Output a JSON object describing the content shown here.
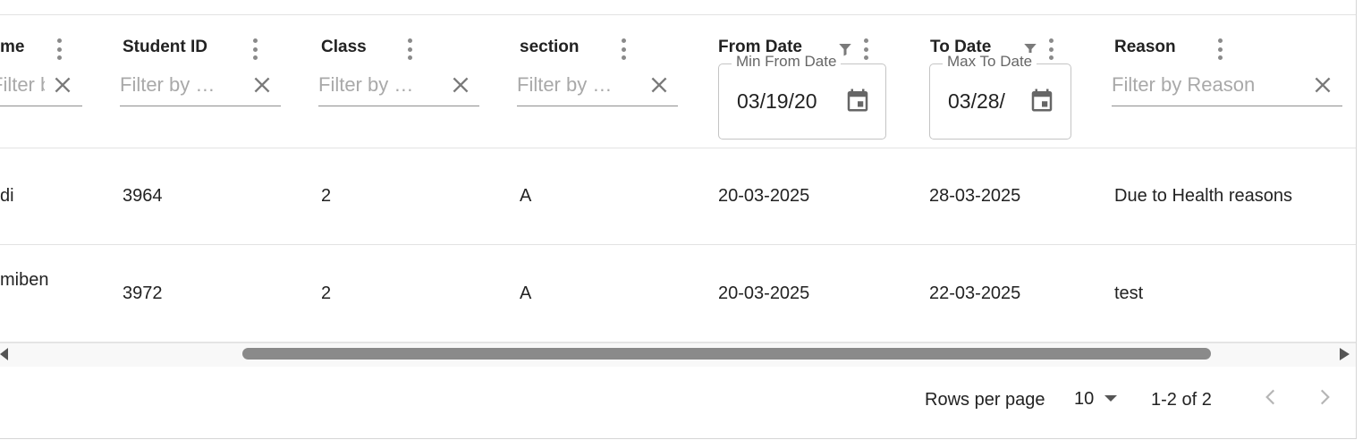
{
  "columns": [
    {
      "key": "name",
      "title": "me",
      "filter_placeholder": "Filter by Stu…"
    },
    {
      "key": "student_id",
      "title": "Student ID",
      "filter_placeholder": "Filter by …"
    },
    {
      "key": "class",
      "title": "Class",
      "filter_placeholder": "Filter by …"
    },
    {
      "key": "section",
      "title": "section",
      "filter_placeholder": "Filter by …"
    },
    {
      "key": "from_date",
      "title": "From Date",
      "filter_label": "Min From Date",
      "filter_value": "03/19/20"
    },
    {
      "key": "to_date",
      "title": "To Date",
      "filter_label": "Max To Date",
      "filter_value": "03/28/"
    },
    {
      "key": "reason",
      "title": "Reason",
      "filter_placeholder": "Filter by Reason"
    }
  ],
  "rows": [
    {
      "name": "di",
      "student_id": "3964",
      "class": "2",
      "section": "A",
      "from_date": "20-03-2025",
      "to_date": "28-03-2025",
      "reason": "Due to Health reasons"
    },
    {
      "name": "miben",
      "student_id": "3972",
      "class": "2",
      "section": "A",
      "from_date": "20-03-2025",
      "to_date": "22-03-2025",
      "reason": "test"
    }
  ],
  "pagination": {
    "rows_per_page_label": "Rows per page",
    "rows_per_page_value": "10",
    "range_label": "1-2 of 2"
  },
  "colors": {
    "accent_gray": "#8a8a8a",
    "border": "#e3e3e3"
  },
  "icons": [
    "kebab-menu-icon",
    "filter-funnel-icon",
    "clear-x-icon",
    "calendar-icon",
    "chevron-left-icon",
    "chevron-right-icon",
    "dropdown-caret-icon"
  ]
}
